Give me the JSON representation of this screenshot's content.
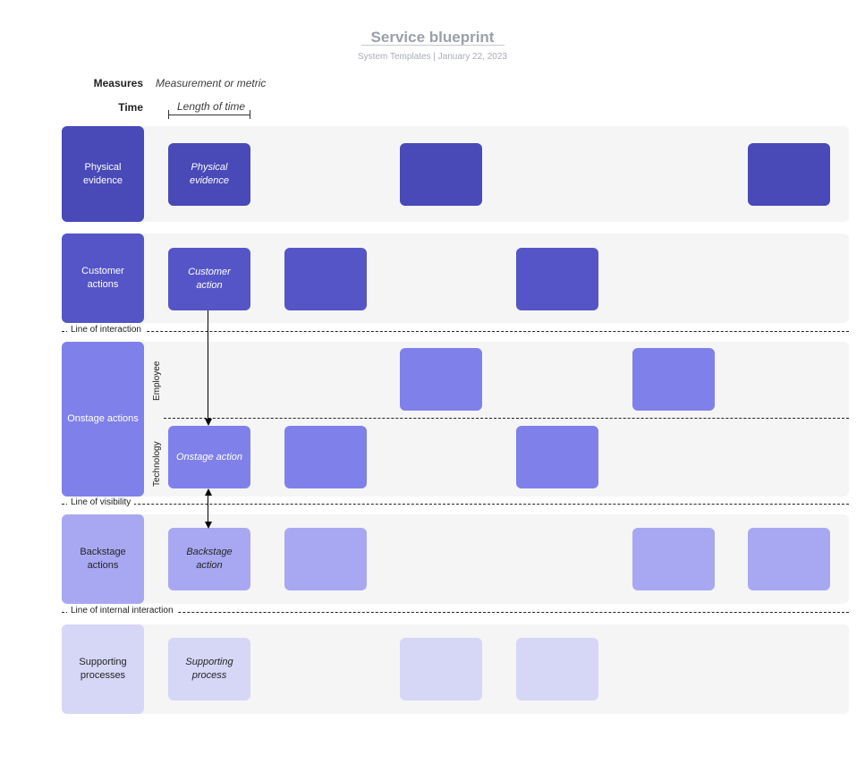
{
  "header": {
    "title": "Service blueprint",
    "subtitle": "System Templates  |  January 22, 2023"
  },
  "meta": {
    "measures_label": "Measures",
    "measures_value": "Measurement or metric",
    "time_label": "Time",
    "time_value": "Length of time"
  },
  "dividers": {
    "interaction": "Line of interaction",
    "visibility": "Line of visibility",
    "internal": "Line of internal interaction"
  },
  "rows": {
    "physical": {
      "label": "Physical evidence",
      "card_text": "Physical evidence"
    },
    "customer": {
      "label": "Customer actions",
      "card_text": "Customer action"
    },
    "onstage": {
      "label": "Onstage actions",
      "sub_employee": "Employee",
      "sub_technology": "Technology",
      "card_text": "Onstage action"
    },
    "backstage": {
      "label": "Backstage actions",
      "card_text": "Backstage action"
    },
    "support": {
      "label": "Supporting processes",
      "card_text": "Supporting process"
    }
  }
}
